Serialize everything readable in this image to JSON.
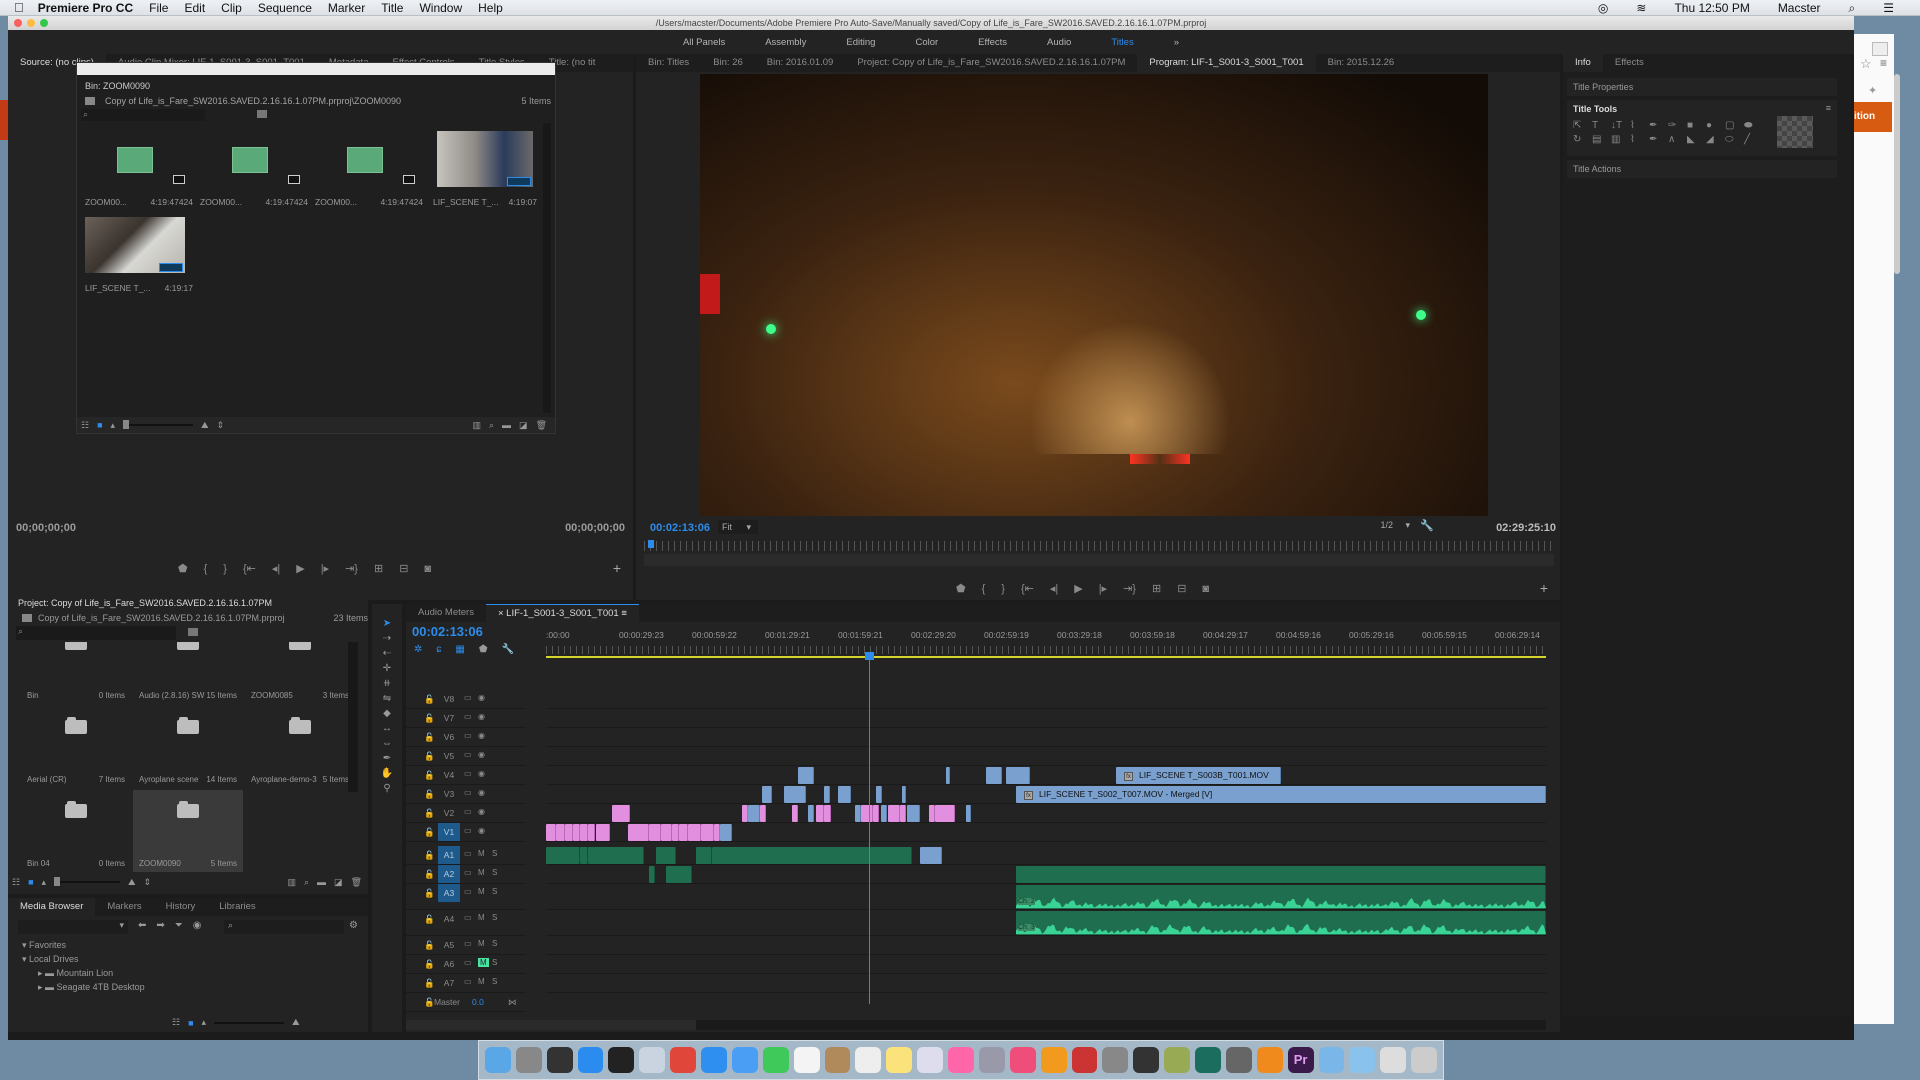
{
  "menubar": {
    "app_name": "Premiere Pro CC",
    "items": [
      "File",
      "Edit",
      "Clip",
      "Sequence",
      "Marker",
      "Title",
      "Window",
      "Help"
    ],
    "clock": "Thu 12:50 PM",
    "user": "Macster"
  },
  "window": {
    "path": "/Users/macster/Documents/Adobe Premiere Pro Auto-Save/Manually saved/Copy of Life_is_Fare_SW2016.SAVED.2.16.16.1.07PM.prproj"
  },
  "workspaces": {
    "items": [
      "All Panels",
      "Assembly",
      "Editing",
      "Color",
      "Effects",
      "Audio",
      "Titles"
    ],
    "active": "Titles",
    "overflow": "»"
  },
  "source_panel": {
    "tabs": [
      "Source: (no clips)",
      "Audio Clip Mixer: LIF-1_S001-3_S001_T001",
      "Metadata",
      "Effect Controls",
      "Title Styles",
      "Title: (no tit"
    ],
    "timecode_in": "00;00;00;00",
    "timecode_out": "00;00;00;00"
  },
  "bin_window": {
    "title": "Bin: ZOOM0090",
    "path": "Copy of Life_is_Fare_SW2016.SAVED.2.16.16.1.07PM.prproj\\ZOOM0090",
    "count": "5 Items",
    "items": [
      {
        "name": "ZOOM00...",
        "duration": "4:19:47424",
        "type": "audio"
      },
      {
        "name": "ZOOM00...",
        "duration": "4:19:47424",
        "type": "audio"
      },
      {
        "name": "ZOOM00...",
        "duration": "4:19:47424",
        "type": "audio"
      },
      {
        "name": "LIF_SCENE T_...",
        "duration": "4:19:07",
        "type": "video"
      },
      {
        "name": "LIF_SCENE T_...",
        "duration": "4:19:17",
        "type": "video"
      }
    ]
  },
  "program_panel": {
    "tabs": [
      "Bin: Titles",
      "Bin: 26",
      "Bin: 2016.01.09",
      "Project: Copy of Life_is_Fare_SW2016.SAVED.2.16.16.1.07PM",
      "Program: LIF-1_S001-3_S001_T001",
      "Bin: 2015.12.26"
    ],
    "active_tab": "Program: LIF-1_S001-3_S001_T001",
    "timecode": "00:02:13:06",
    "fit": "Fit",
    "resolution": "1/2",
    "duration": "02:29:25:10"
  },
  "right_panel": {
    "tabs": [
      "Info",
      "Effects"
    ],
    "sections": [
      "Title Properties",
      "Title Tools",
      "Title Actions"
    ]
  },
  "project_panel": {
    "title": "Project: Copy of Life_is_Fare_SW2016.SAVED.2.16.16.1.07PM",
    "path": "Copy of Life_is_Fare_SW2016.SAVED.2.16.16.1.07PM.prproj",
    "count": "23 Items",
    "bins": [
      {
        "name": "Bin",
        "count": "0 Items"
      },
      {
        "name": "Audio (2.8.16) SW",
        "count": "15 Items"
      },
      {
        "name": "ZOOM0085",
        "count": "3 Items"
      },
      {
        "name": "Aerial (CR)",
        "count": "7 Items"
      },
      {
        "name": "Ayroplane scene",
        "count": "14 Items"
      },
      {
        "name": "Ayroplane-demo-3",
        "count": "5 Items"
      },
      {
        "name": "Bin 04",
        "count": "0 Items"
      },
      {
        "name": "ZOOM0090",
        "count": "5 Items"
      }
    ],
    "selected_bin": "ZOOM0090"
  },
  "media_browser": {
    "tabs": [
      "Media Browser",
      "Markers",
      "History",
      "Libraries"
    ],
    "tree": [
      "Favorites",
      "Local Drives",
      "Mountain Lion",
      "Seagate 4TB Desktop"
    ]
  },
  "timeline": {
    "tabs": [
      "Audio Meters",
      "LIF-1_S001-3_S001_T001"
    ],
    "active_tab": "LIF-1_S001-3_S001_T001",
    "timecode": "00:02:13:06",
    "ruler": [
      ":00:00",
      "00:00:29:23",
      "00:00:59:22",
      "00:01:29:21",
      "00:01:59:21",
      "00:02:29:20",
      "00:02:59:19",
      "00:03:29:18",
      "00:03:59:18",
      "00:04:29:17",
      "00:04:59:16",
      "00:05:29:16",
      "00:05:59:15",
      "00:06:29:14"
    ],
    "video_tracks": [
      "V8",
      "V7",
      "V6",
      "V5",
      "V4",
      "V3",
      "V2",
      "V1"
    ],
    "audio_tracks": [
      "A1",
      "A2",
      "A3",
      "A4",
      "A5",
      "A6",
      "A7"
    ],
    "master_label": "Master",
    "master_value": "0.0",
    "clip_v4_label": "LIF_SCENE T_S003B_T001.MOV",
    "clip_v3_label": "LIF_SCENE T_S002_T007.MOV - Merged [V]",
    "ch2": "Ch. 2",
    "ch3": "Ch. 3"
  }
}
